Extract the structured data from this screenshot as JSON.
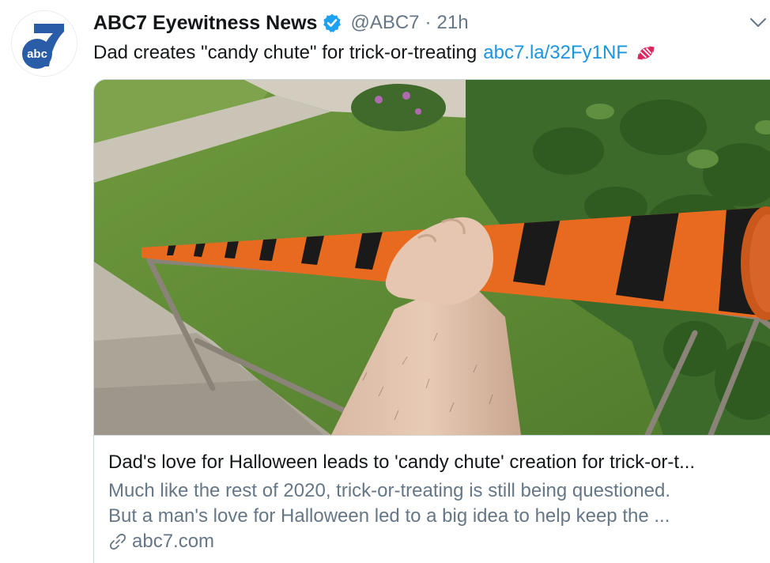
{
  "account": {
    "display_name": "ABC7 Eyewitness News",
    "handle": "@ABC7",
    "separator": "·",
    "time": "21h",
    "avatar_text": "abc"
  },
  "tweet": {
    "text": "Dad creates \"candy chute\" for trick-or-treating",
    "link": "abc7.la/32Fy1NF",
    "emoji": "candy-icon"
  },
  "card": {
    "title": "Dad's love for Halloween leads to 'candy chute' creation for trick-or-t...",
    "description_line1": "Much like the rest of 2020, trick-or-treating is still being questioned.",
    "description_line2": "But a man's love for Halloween led to a big idea to help keep the ...",
    "domain": "abc7.com"
  },
  "colors": {
    "link": "#1b95e0",
    "text": "#14171a",
    "muted": "#657786",
    "verified": "#1da1f2",
    "abc_blue": "#2a5da8"
  }
}
